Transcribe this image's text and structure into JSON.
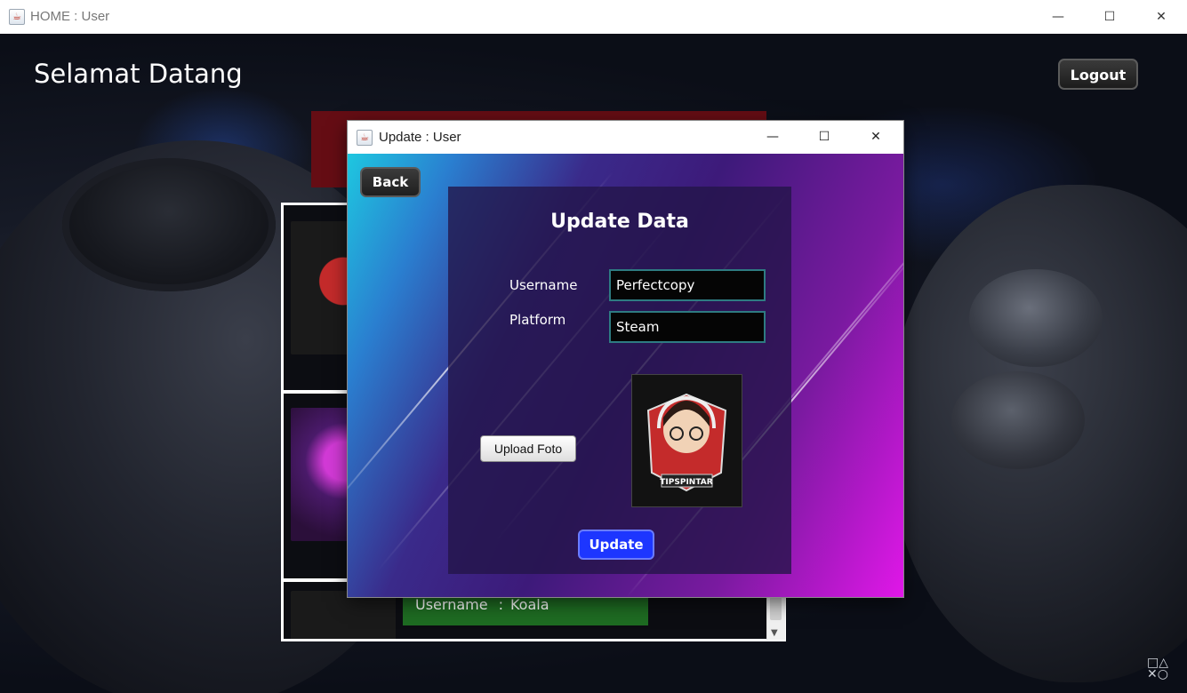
{
  "main_window": {
    "title": "HOME : User",
    "controls": {
      "minimize": "—",
      "maximize": "☐",
      "close": "✕"
    }
  },
  "home": {
    "welcome": "Selamat Datang",
    "logout_label": "Logout",
    "user_list": [
      {
        "thumb": "avatar-tipspintar"
      },
      {
        "thumb": "avatar-ninja"
      },
      {
        "thumb": "avatar-hooded",
        "username_label": "Username",
        "separator": ":",
        "username": "Koala"
      }
    ]
  },
  "dialog": {
    "title": "Update : User",
    "controls": {
      "minimize": "—",
      "maximize": "☐",
      "close": "✕"
    },
    "back_label": "Back",
    "heading": "Update Data",
    "username_label": "Username",
    "username_value": "Perfectcopy",
    "platform_label": "Platform",
    "platform_value": "Steam",
    "upload_label": "Upload Foto",
    "update_label": "Update",
    "photo": "avatar-tipspintar",
    "photo_caption": "TIPSPINTAR"
  },
  "colors": {
    "update_button": "#1d36ff",
    "green_info": "#1e6b22",
    "red_bar": "#650d14",
    "dialog_gradient_start": "#1ec7e0",
    "dialog_gradient_end": "#e017e8"
  }
}
